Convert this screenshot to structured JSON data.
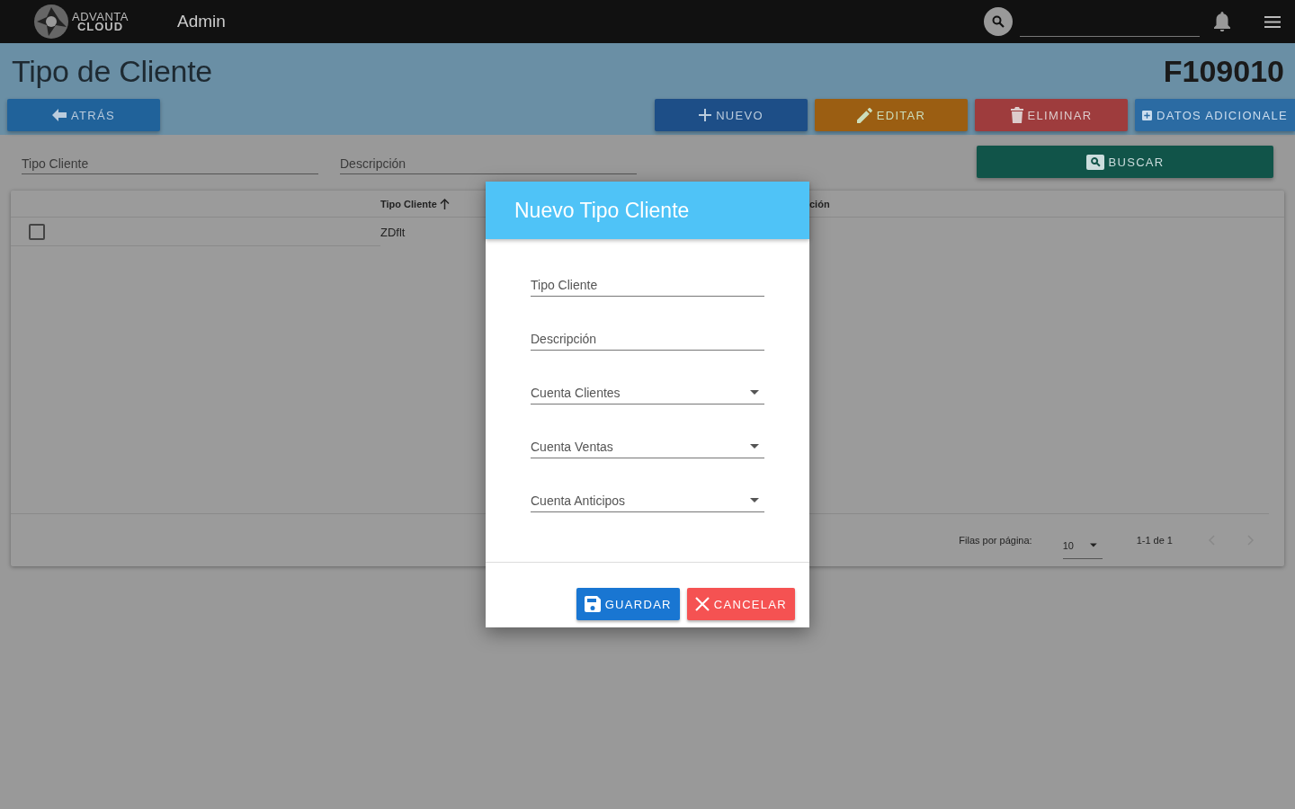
{
  "topbar": {
    "logo_line_1": "ADVANTA",
    "logo_line_2": "CLOUD",
    "title": "Admin"
  },
  "page": {
    "title": "Tipo de Cliente",
    "code": "F109010"
  },
  "actions": [
    {
      "kind": "back",
      "label": "ATRÁS"
    },
    {
      "kind": "new",
      "label": "NUEVO"
    },
    {
      "kind": "edit",
      "label": "EDITAR"
    },
    {
      "kind": "delete",
      "label": "ELIMINAR"
    },
    {
      "kind": "extra",
      "label": "DATOS ADICIONALE"
    }
  ],
  "filters": [
    {
      "placeholder": "Tipo Cliente"
    },
    {
      "placeholder": "Descripción"
    }
  ],
  "search_button": {
    "label": "BUSCAR"
  },
  "table": {
    "columns": [
      {
        "label": "Tipo Cliente",
        "sorted": true
      },
      {
        "label": "ción",
        "sorted": false
      }
    ],
    "rows": [
      {
        "checked": false,
        "cells": [
          "ZDflt"
        ]
      }
    ]
  },
  "pagination": {
    "rows_label": "Filas por página:",
    "rows_per_page": "10",
    "range": "1-1 de 1"
  },
  "dialog": {
    "title": "Nuevo Tipo Cliente",
    "fields": [
      {
        "kind": "text",
        "placeholder": "Tipo Cliente"
      },
      {
        "kind": "text",
        "placeholder": "Descripción"
      },
      {
        "kind": "select",
        "placeholder": "Cuenta Clientes"
      },
      {
        "kind": "select",
        "placeholder": "Cuenta Ventas"
      },
      {
        "kind": "select",
        "placeholder": "Cuenta Anticipos"
      }
    ],
    "buttons": [
      {
        "kind": "save",
        "label": "GUARDAR"
      },
      {
        "kind": "cancel",
        "label": "CANCELAR"
      }
    ]
  }
}
